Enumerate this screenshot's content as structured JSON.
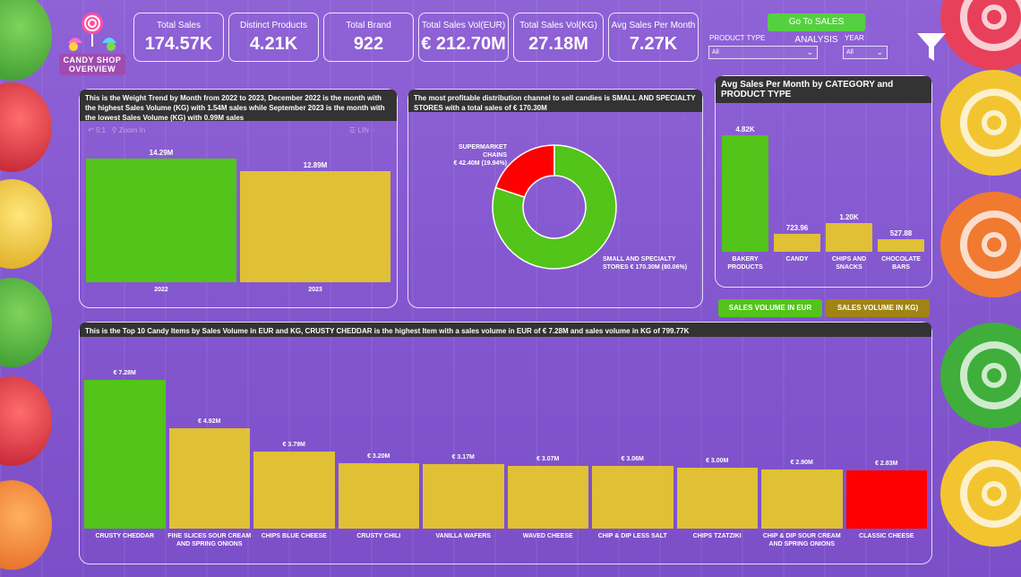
{
  "logo": {
    "text": "CANDY SHOP",
    "subtitle": "OVERVIEW"
  },
  "kpis": [
    {
      "label": "Total Sales",
      "value": "174.57K"
    },
    {
      "label": "Distinct Products",
      "value": "4.21K"
    },
    {
      "label": "Total Brand",
      "value": "922"
    },
    {
      "label": "Total Sales Vol(EUR)",
      "value": "€ 212.70M"
    },
    {
      "label": "Total Sales Vol(KG)",
      "value": "27.18M"
    },
    {
      "label": "Avg Sales Per Month",
      "value": "7.27K"
    }
  ],
  "nav": {
    "sales_analysis_button": "Go To SALES ANALYSIS"
  },
  "slicers": {
    "product_type": {
      "label": "PRODUCT TYPE",
      "value": "All"
    },
    "year": {
      "label": "YEAR",
      "value": "All"
    }
  },
  "icons": {
    "filter": "filter-icon",
    "candy_logo": "candy-logo-icon"
  },
  "colors": {
    "green": "#52c41a",
    "gold": "#e0c035",
    "red": "#ff0000",
    "background": "#8a5cd2",
    "title_bg": "#333333",
    "toggle_eur": "#52c41a",
    "toggle_kg": "#a08414"
  },
  "weight_trend": {
    "title": "This is the Weight Trend by Month from 2022 to 2023, December 2022 is the month with the highest Sales Volume (KG) with 1.54M sales while September 2023 is the month with the lowest Sales Volume (KG) with 0.99M sales",
    "toolbar": {
      "back": "5:1",
      "zoom": "Zoom In",
      "list": "LIN"
    }
  },
  "channel": {
    "title": "The most profitable distribution channel to sell candies is SMALL AND SPECIALTY STORES with a total sales of € 170.30M",
    "slices": [
      {
        "label_line1": "SUPERMARKET CHAINS",
        "label_line2": "€ 42.40M (19.94%)"
      },
      {
        "label_line1": "SMALL AND SPECIALTY",
        "label_line2": "STORES € 170.30M (80.06%)"
      }
    ]
  },
  "category": {
    "title": "Avg Sales Per Month by CATEGORY and PRODUCT TYPE"
  },
  "toggles": {
    "eur": "SALES VOLUME IN EUR",
    "kg": "SALES VOLUME IN KG)"
  },
  "top10": {
    "title": "This is the Top 10 Candy Items by Sales Volume in EUR and KG, CRUSTY CHEDDAR is the highest Item with a sales volume in EUR of € 7.28M and sales volume in KG of 799.77K"
  },
  "chart_data": [
    {
      "type": "bar",
      "categories": [
        "2022",
        "2023"
      ],
      "values": [
        14.29,
        12.89
      ],
      "value_labels": [
        "14.29M",
        "12.89M"
      ],
      "colors": [
        "#52c41a",
        "#e0c035"
      ],
      "ylim": [
        0,
        14.29
      ]
    },
    {
      "type": "pie",
      "categories": [
        "SUPERMARKET CHAINS",
        "SMALL AND SPECIALTY STORES"
      ],
      "values": [
        42.4,
        170.3
      ],
      "percent": [
        19.94,
        80.06
      ],
      "colors": [
        "#ff0000",
        "#52c41a"
      ]
    },
    {
      "type": "bar",
      "categories": [
        "BAKERY PRODUCTS",
        "CANDY",
        "CHIPS AND SNACKS",
        "CHOCOLATE BARS"
      ],
      "category_lines": [
        [
          "BAKERY",
          "PRODUCTS"
        ],
        [
          "CANDY"
        ],
        [
          "CHIPS AND",
          "SNACKS"
        ],
        [
          "CHOCOLATE",
          "BARS"
        ]
      ],
      "values": [
        4820,
        723.96,
        1200,
        527.88
      ],
      "value_labels": [
        "4.82K",
        "723.96",
        "1.20K",
        "527.88"
      ],
      "colors": [
        "#52c41a",
        "#e0c035",
        "#e0c035",
        "#e0c035"
      ],
      "ylim": [
        0,
        4820
      ]
    },
    {
      "type": "bar",
      "categories": [
        "CRUSTY CHEDDAR",
        "FINE SLICES SOUR CREAM AND SPRING ONIONS",
        "CHIPS BLUE CHEESE",
        "CRUSTY CHILI",
        "VANILLA WAFERS",
        "WAVED CHEESE",
        "CHIP & DIP LESS SALT",
        "CHIPS TZATZIKI",
        "CHIP & DIP SOUR CREAM AND SPRING ONIONS",
        "CLASSIC CHEESE"
      ],
      "category_lines": [
        [
          "CRUSTY CHEDDAR"
        ],
        [
          "FINE SLICES SOUR CREAM",
          "AND SPRING ONIONS"
        ],
        [
          "CHIPS BLUE CHEESE"
        ],
        [
          "CRUSTY CHILI"
        ],
        [
          "VANILLA WAFERS"
        ],
        [
          "WAVED CHEESE"
        ],
        [
          "CHIP & DIP LESS SALT"
        ],
        [
          "CHIPS TZATZIKI"
        ],
        [
          "CHIP & DIP SOUR CREAM",
          "AND SPRING ONIONS"
        ],
        [
          "CLASSIC CHEESE"
        ]
      ],
      "values": [
        7.28,
        4.92,
        3.79,
        3.2,
        3.17,
        3.07,
        3.06,
        3.0,
        2.9,
        2.83
      ],
      "value_labels": [
        "€ 7.28M",
        "€ 4.92M",
        "€ 3.79M",
        "€ 3.20M",
        "€ 3.17M",
        "€ 3.07M",
        "€ 3.06M",
        "€ 3.00M",
        "€ 2.90M",
        "€ 2.83M"
      ],
      "colors": [
        "#52c41a",
        "#e0c035",
        "#e0c035",
        "#e0c035",
        "#e0c035",
        "#e0c035",
        "#e0c035",
        "#e0c035",
        "#e0c035",
        "#ff0000"
      ],
      "ylim": [
        0,
        7.28
      ]
    }
  ]
}
